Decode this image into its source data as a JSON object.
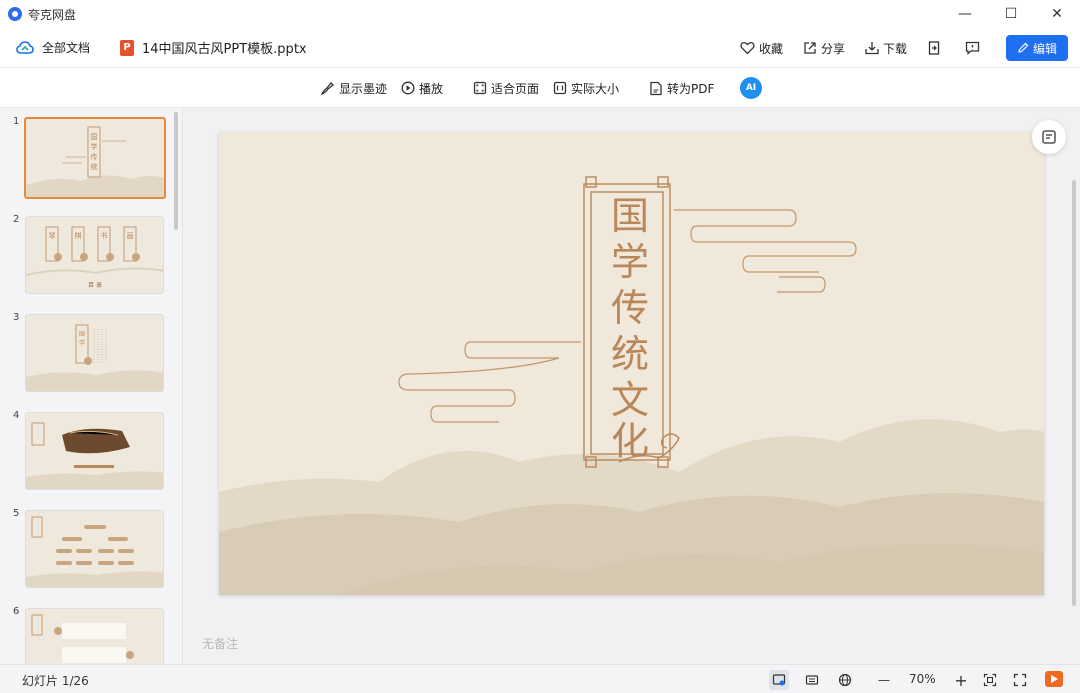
{
  "window": {
    "app_name": "夸克网盘",
    "minimize_label": "—",
    "maximize_label": "☐",
    "close_label": "✕"
  },
  "doc": {
    "all_docs": "全部文档",
    "ppt_badge": "P",
    "file_name": "14中国风古风PPT模板.pptx",
    "actions": {
      "favorite": "收藏",
      "share": "分享",
      "download": "下载",
      "edit": "编辑"
    }
  },
  "toolbar": {
    "show_ink": "显示墨迹",
    "play": "播放",
    "fit_page": "适合页面",
    "actual_size": "实际大小",
    "to_pdf": "转为PDF",
    "ai_badge": "AI"
  },
  "thumbnails": [
    {
      "num": "1"
    },
    {
      "num": "2"
    },
    {
      "num": "3"
    },
    {
      "num": "4"
    },
    {
      "num": "5"
    },
    {
      "num": "6"
    }
  ],
  "thumb_text": {
    "t1_title": "国学传统文化",
    "t2_chars": [
      "琴",
      "棋",
      "书",
      "画"
    ],
    "t2_footer": "目 录",
    "t3_title": "国学传统"
  },
  "slide": {
    "title_chars": [
      "国",
      "学",
      "传",
      "统",
      "文",
      "化"
    ],
    "accent_color": "#b9875a",
    "background_color": "#efe8db"
  },
  "notes_placeholder": "无备注",
  "status": {
    "slide_count": "幻灯片 1/26",
    "zoom_minus": "—",
    "zoom": "70%",
    "zoom_plus": "+"
  }
}
